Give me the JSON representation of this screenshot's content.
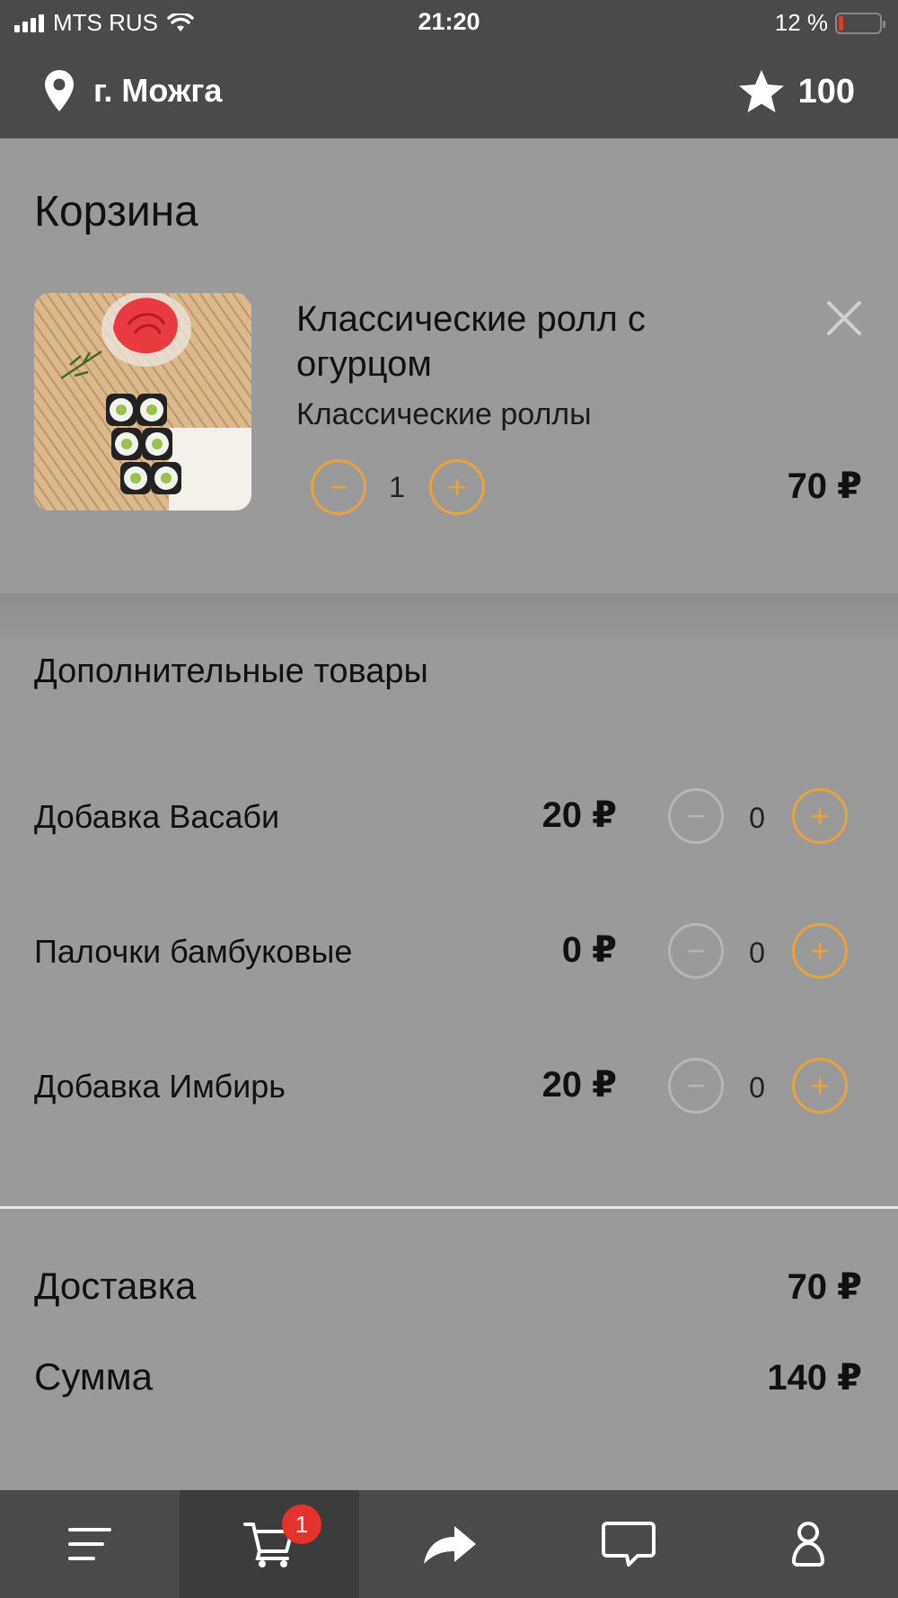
{
  "status_bar": {
    "carrier": "MTS RUS",
    "time": "21:20",
    "battery": "12 %"
  },
  "header": {
    "city": "г. Можга",
    "points": "100"
  },
  "cart": {
    "title": "Корзина",
    "item": {
      "name": "Классические ролл с огурцом",
      "category": "Классические роллы",
      "quantity": "1",
      "price": "70 ₽",
      "image": "sushi-rolls-photo"
    }
  },
  "extras": {
    "title": "Дополнительные товары",
    "items": [
      {
        "name": "Добавка Васаби",
        "price": "20 ₽",
        "quantity": "0"
      },
      {
        "name": "Палочки бамбуковые",
        "price": "0 ₽",
        "quantity": "0"
      },
      {
        "name": "Добавка Имбирь",
        "price": "20 ₽",
        "quantity": "0"
      }
    ]
  },
  "totals": {
    "delivery_label": "Доставка",
    "delivery_value": "70 ₽",
    "sum_label": "Сумма",
    "sum_value": "140 ₽"
  },
  "tab_bar": {
    "cart_badge": "1",
    "icons": [
      "menu-icon",
      "cart-icon",
      "share-icon",
      "chat-icon",
      "profile-icon"
    ]
  },
  "colors": {
    "accent": "#e8a23c",
    "badge": "#e5322d",
    "bar_bg": "#4a4a4a",
    "page_bg": "#9a9a9a"
  }
}
